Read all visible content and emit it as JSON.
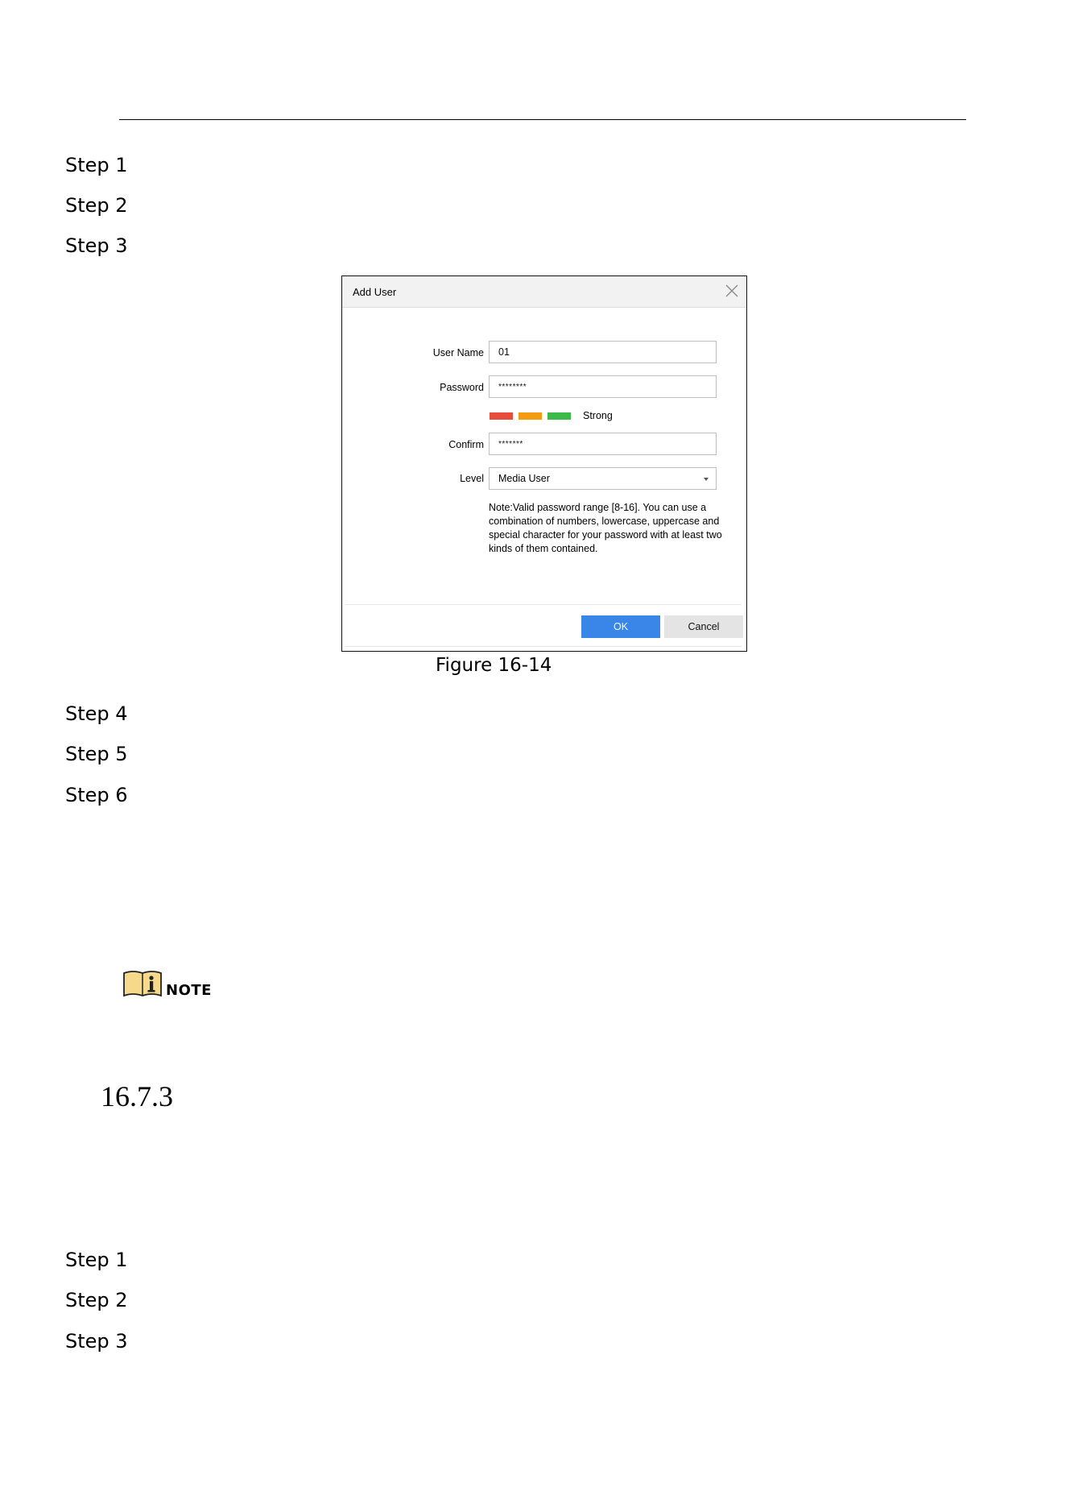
{
  "steps_top": [
    "Step 1",
    "Step 2",
    "Step 3"
  ],
  "dialog": {
    "title": "Add User",
    "fields": {
      "user_name_label": "User Name",
      "user_name_value": "01",
      "password_label": "Password",
      "password_value": "********",
      "confirm_label": "Confirm",
      "confirm_value": "*******",
      "level_label": "Level",
      "level_value": "Media User"
    },
    "strength": {
      "label": "Strong",
      "colors": [
        "#e84c3d",
        "#f39c12",
        "#3dbb4a"
      ]
    },
    "note": "Note:Valid password range [8-16]. You can use a combination of numbers, lowercase, uppercase and special character for your password with at least two kinds of them contained.",
    "ok_label": "OK",
    "cancel_label": "Cancel"
  },
  "figure_caption": "Figure 16-14",
  "steps_middle": [
    "Step 4",
    "Step 5",
    "Step 6"
  ],
  "note_label": "NOTE",
  "section_number": "16.7.3",
  "steps_bottom": [
    "Step 1",
    "Step 2",
    "Step 3"
  ]
}
